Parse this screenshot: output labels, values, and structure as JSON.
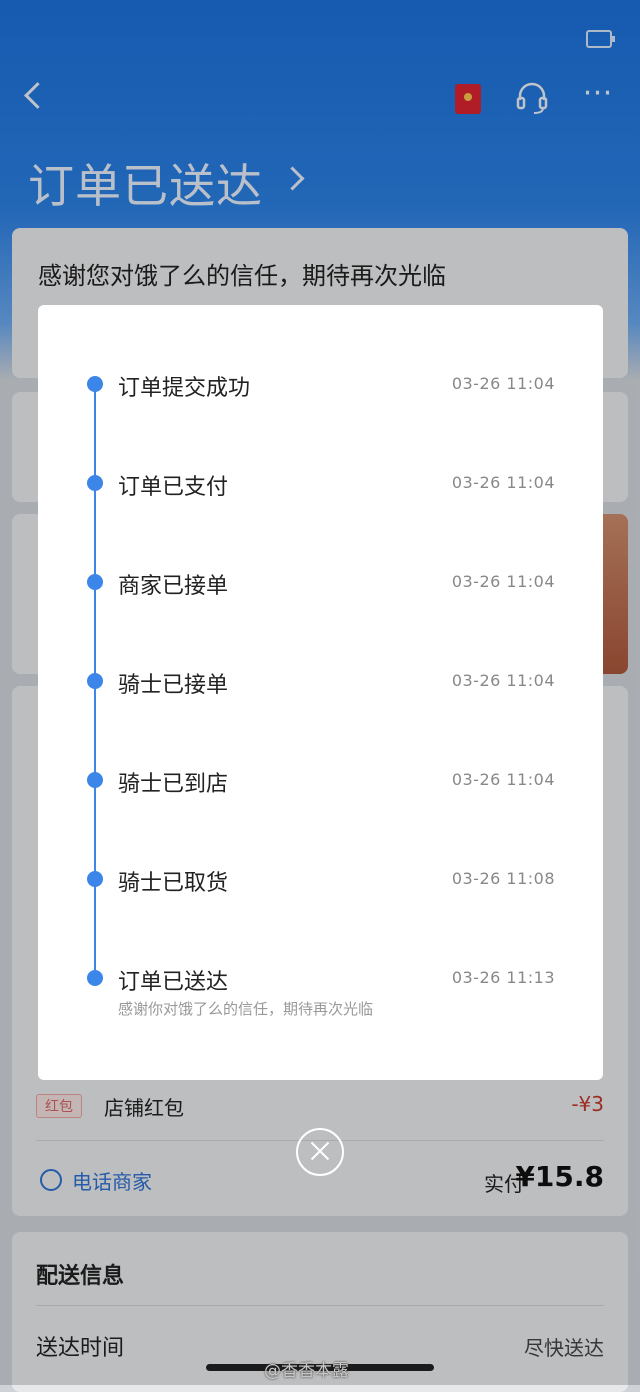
{
  "header": {
    "title": "订单已送达",
    "icons": [
      "back-icon",
      "redpacket-icon",
      "headset-icon",
      "more-icon"
    ]
  },
  "background": {
    "thanks_text": "感谢您对饿了么的信任，期待再次光临",
    "redpacket_tag": "红包",
    "redpacket_label": "店铺红包",
    "redpacket_amount": "-¥3",
    "phone_label": "电话商家",
    "paid_label": "实付",
    "paid_amount": "¥15.8",
    "delivery_title": "配送信息",
    "delivery_time_label": "送达时间",
    "delivery_time_value": "尽快送达"
  },
  "timeline": {
    "steps": [
      {
        "label": "订单提交成功",
        "time": "03-26 11:04"
      },
      {
        "label": "订单已支付",
        "time": "03-26 11:04"
      },
      {
        "label": "商家已接单",
        "time": "03-26 11:04"
      },
      {
        "label": "骑士已接单",
        "time": "03-26 11:04"
      },
      {
        "label": "骑士已到店",
        "time": "03-26 11:04"
      },
      {
        "label": "骑士已取货",
        "time": "03-26 11:08"
      },
      {
        "label": "订单已送达",
        "time": "03-26 11:13",
        "note": "感谢你对饿了么的信任，期待再次光临"
      }
    ]
  },
  "watermark": "@香香本露",
  "colors": {
    "brand_blue": "#1b6fd6",
    "timeline_blue": "#3b86e8",
    "discount_red": "#c0392b"
  }
}
